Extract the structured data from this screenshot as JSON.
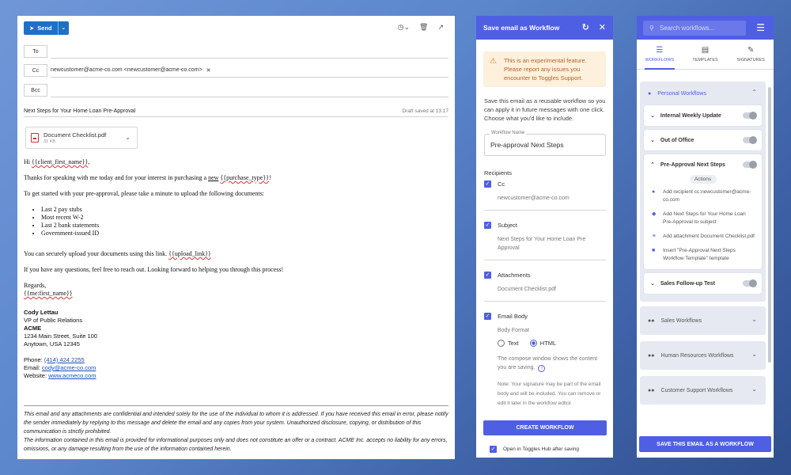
{
  "compose": {
    "send_label": "Send",
    "to_label": "To",
    "cc_label": "Cc",
    "bcc_label": "Bcc",
    "cc_value": "newcustomer@acme-co.com <newcustomer@acme-co.com>",
    "subject": "Next Steps for Your Home Loan Pre-Approval",
    "draft_saved": "Draft saved at 13:17",
    "attachment": {
      "name": "Document Checklist.pdf",
      "size": "31 KB"
    },
    "body": {
      "greeting_prefix": "Hi ",
      "greeting_var": "{{client_first_name}}",
      "greeting_suffix": ",",
      "line1_prefix": "Thanks for speaking with me today and for your interest in purchasing a ",
      "line1_link": "new",
      "line1_var": "{{purchase_type}}",
      "line1_suffix": "!",
      "line2": "To get started with your pre-approval, please take a minute to upload the following documents:",
      "docs": [
        "Last 2 pay stubs",
        "Most recent W-2",
        "Last 2 bank statements",
        "Government-issued ID"
      ],
      "line3_prefix": "You can securely upload your documents using this link. ",
      "line3_var": "{{upload_link}}",
      "line4": "If you have any questions, feel free to reach out. Looking forward to helping you through this process!",
      "regards": "Regards,",
      "sender_var": "{{me:first_name}}"
    },
    "signature": {
      "name": "Cody Lettau",
      "title": "VP of Public Relations",
      "company": "ACME",
      "address1": "1234 Main Street, Suite 100",
      "address2": "Anytown, USA 12345",
      "phone_label": "Phone: ",
      "phone": "(414) 424 2255",
      "email_label": "Email: ",
      "email": "cody@acme-co.com",
      "website_label": "Website: ",
      "website": "www.acmeco.com"
    },
    "disclaimer1": "This email and any attachments are confidential and intended solely for the use of the individual to whom it is addressed. If you have received this email in error, please notify the sender immediately by replying to this message and delete the email and any copies from your system. Unauthorized disclosure, copying, or distribution of this communication is strictly prohibited.",
    "disclaimer2": "The information contained in this email is provided for informational purposes only and does not constitute an offer or a contract. ACME Inc. accepts no liability for any errors, omissions, or any damage resulting from the use of the information contained herein."
  },
  "save_panel": {
    "title": "Save email as Workflow",
    "warning": "This is an experimental feature. Please report any issues you encounter to Toggles Support.",
    "intro": "Save this email as a reusable workflow so you can apply it in future messages with one click. Choose what you'd like to include.",
    "workflow_name_label": "Workflow Name",
    "workflow_name": "Pre-approval Next Steps",
    "recipients_label": "Recipients",
    "cc_label": "Cc",
    "cc_value": "newcustomer@acme-co.com",
    "subject_label": "Subject",
    "subject_value": "Next Steps for Your Home Loan Pre Approval",
    "attachments_label": "Attachments",
    "attachments_value": "Document Checklist.pdf",
    "email_body_label": "Email Body",
    "body_format_label": "Body Format",
    "format_text": "Text",
    "format_html": "HTML",
    "compose_note": "The compose window shows the content you are saving.",
    "signature_note": "Note: Your signature may be part of the email body and will be included. You can remove or edit it later in the workflow editor.",
    "create_button": "CREATE WORKFLOW",
    "open_hub": "Open in Toggles Hub after saving"
  },
  "list_panel": {
    "search_placeholder": "Search workflows...",
    "tabs": [
      {
        "label": "WORKFLOWS",
        "icon": "checklist-icon"
      },
      {
        "label": "TEMPLATES",
        "icon": "template-icon"
      },
      {
        "label": "SIGNATURES",
        "icon": "signature-icon"
      }
    ],
    "personal_group": "Personal Workflows",
    "workflows": [
      "Internal Weekly Update",
      "Out of Office",
      "Pre-Approval Next Steps",
      "Sales Follow-up Test"
    ],
    "actions_label": "Actions",
    "actions": [
      "Add recipient cc:newcustomer@acme-co.com",
      "Add Next Steps for Your Home Loan Pre-Approval to subject",
      "Add attachment Document Checklist.pdf",
      "Insert \"Pre-Approval Next Steps Workflow Template\" template"
    ],
    "groups": [
      "Sales Workflows",
      "Human Resources Workflows",
      "Customer Support Workflows"
    ],
    "save_button": "SAVE THIS EMAIL AS A WORKFLOW"
  },
  "colors": {
    "accent": "#4f5fe3",
    "send_blue": "#1f6fc7",
    "warning_bg": "#fdf0dc",
    "warning_text": "#b3642a"
  }
}
